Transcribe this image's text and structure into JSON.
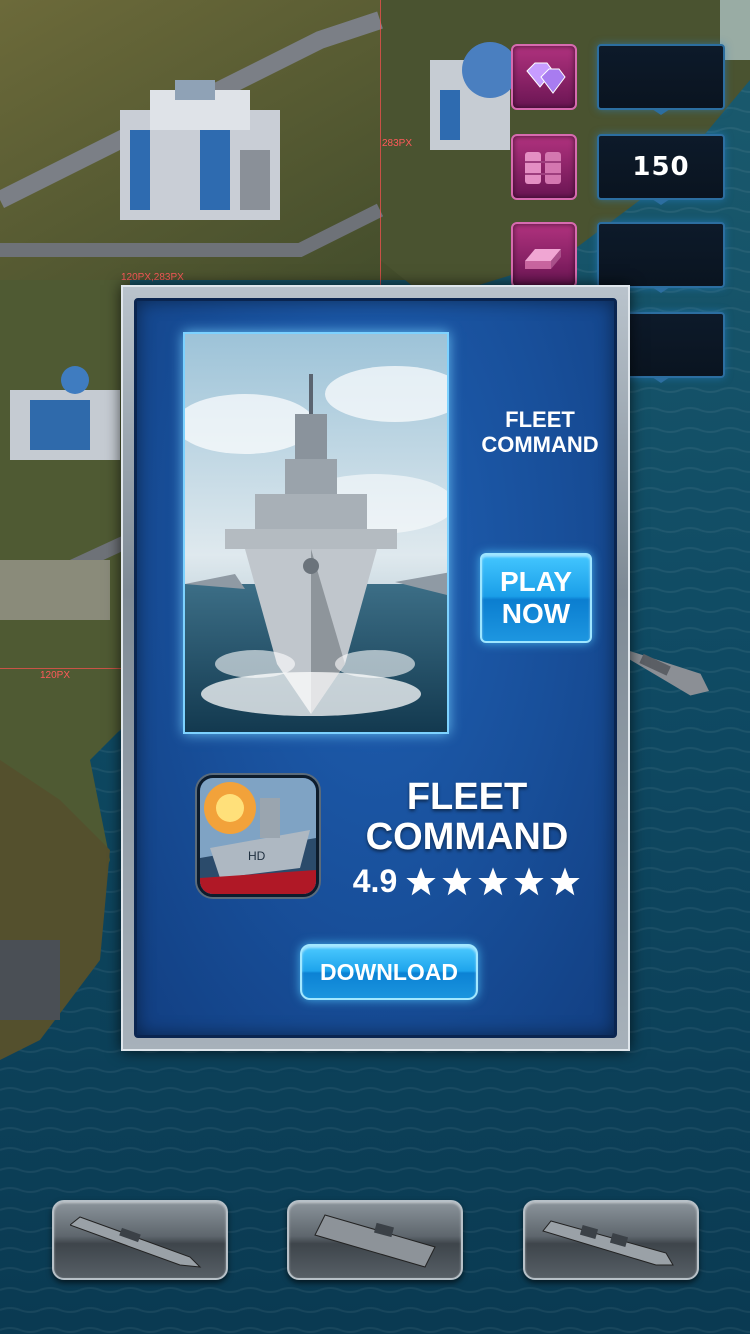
{
  "guides": {
    "label_top": "283PX",
    "label_corner": "120PX,283PX",
    "label_left": "120PX"
  },
  "resources": [
    {
      "icon": "gems-icon",
      "value": ""
    },
    {
      "icon": "oil-barrels-icon",
      "value": "150"
    },
    {
      "icon": "metal-ingots-icon",
      "value": ""
    },
    {
      "icon": "",
      "value": ""
    }
  ],
  "popup": {
    "promo_title": "FLEET COMMAND",
    "play_button": "PLAY NOW",
    "app_name": "FLEET COMMAND",
    "rating": "4.9",
    "stars": 5,
    "download_button": "DOWNLOAD",
    "app_icon_badge": "HD"
  },
  "ship_bar": [
    {
      "icon": "destroyer-icon"
    },
    {
      "icon": "aircraft-carrier-icon"
    },
    {
      "icon": "battleship-icon"
    }
  ],
  "colors": {
    "popup_blue": "#184f9a",
    "button_blue": "#1a9ee8",
    "resource_pink": "#b0327e",
    "ocean": "#0e4860"
  }
}
